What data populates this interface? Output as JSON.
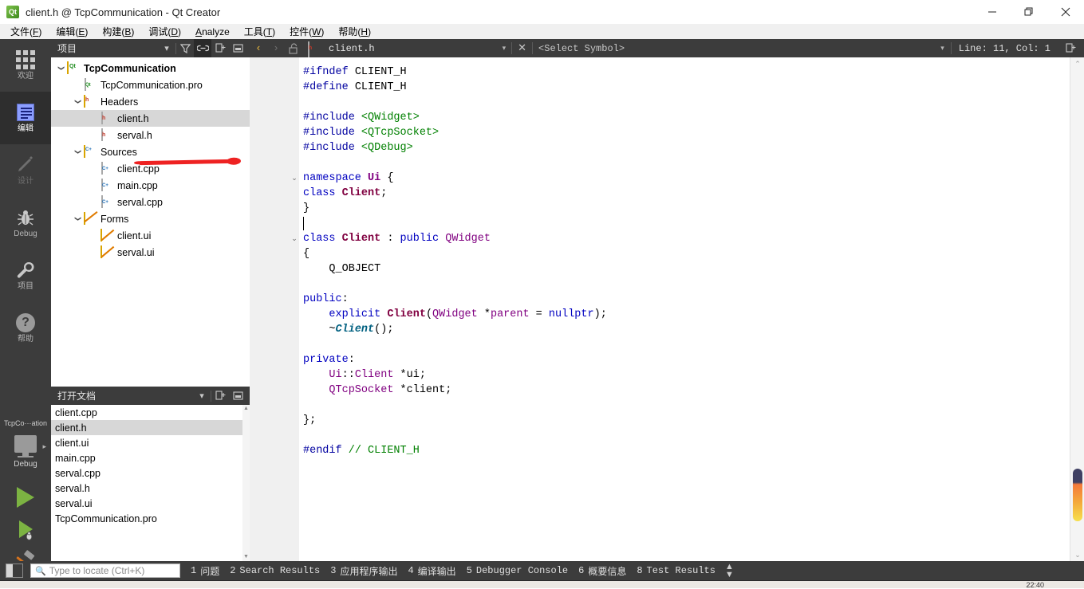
{
  "window": {
    "title": "client.h @ TcpCommunication - Qt Creator",
    "app_icon": "qt-logo-icon",
    "minimize": "—",
    "maximize": "❐",
    "close": "✕"
  },
  "menubar": {
    "items": [
      {
        "name": "file",
        "label": "文件(F)",
        "plain": "文件",
        "mnemonic": "F"
      },
      {
        "name": "edit",
        "label": "编辑(E)",
        "plain": "编辑",
        "mnemonic": "E"
      },
      {
        "name": "build",
        "label": "构建(B)",
        "plain": "构建",
        "mnemonic": "B"
      },
      {
        "name": "debug",
        "label": "调试(D)",
        "plain": "调试",
        "mnemonic": "D"
      },
      {
        "name": "analyze",
        "label": "Analyze",
        "plain": "Analyze",
        "mnemonic": "A"
      },
      {
        "name": "tools",
        "label": "工具(T)",
        "plain": "工具",
        "mnemonic": "T"
      },
      {
        "name": "widgets",
        "label": "控件(W)",
        "plain": "控件",
        "mnemonic": "W"
      },
      {
        "name": "help",
        "label": "帮助(H)",
        "plain": "帮助",
        "mnemonic": "H"
      }
    ]
  },
  "activitybar": {
    "modes": [
      {
        "name": "welcome",
        "label": "欢迎",
        "icon": "grid-icon",
        "state": "normal"
      },
      {
        "name": "edit",
        "label": "编辑",
        "icon": "edit-icon",
        "state": "active"
      },
      {
        "name": "design",
        "label": "设计",
        "icon": "pencil-icon",
        "state": "disabled"
      },
      {
        "name": "debug",
        "label": "Debug",
        "icon": "bug-icon",
        "state": "normal"
      },
      {
        "name": "projects",
        "label": "项目",
        "icon": "wrench-icon",
        "state": "normal"
      },
      {
        "name": "help",
        "label": "帮助",
        "icon": "question-icon",
        "state": "normal"
      }
    ],
    "kit_selector": {
      "project_name": "TcpCo···ation",
      "build_config": "Debug",
      "icon": "monitor-icon",
      "arrow": "▸"
    },
    "actions": [
      {
        "name": "run",
        "label": "",
        "icon": "run-triangle-icon"
      },
      {
        "name": "debug-run",
        "label": "",
        "icon": "run-debug-icon"
      },
      {
        "name": "build",
        "label": "",
        "icon": "hammer-icon"
      }
    ]
  },
  "project_panel": {
    "title": "项目",
    "dropdown": "▾",
    "buttons": [
      {
        "name": "filter",
        "icon": "filter-icon",
        "glyph": "▼",
        "active": false
      },
      {
        "name": "sync-selection",
        "icon": "link-icon",
        "glyph": "⚭",
        "active": true
      },
      {
        "name": "split",
        "icon": "split-add-icon",
        "glyph": "⬚",
        "active": false
      },
      {
        "name": "close-pane",
        "icon": "close-pane-icon",
        "glyph": "▣",
        "active": false
      }
    ],
    "tree": [
      {
        "name": "project-root",
        "label": "TcpCommunication",
        "depth": 0,
        "icon": "qt-project-icon",
        "twisty": "⌄",
        "bold": true,
        "selected": false
      },
      {
        "name": "file-pro",
        "label": "TcpCommunication.pro",
        "depth": 1,
        "icon": "pro-file-icon",
        "twisty": "",
        "bold": false,
        "selected": false
      },
      {
        "name": "folder-headers",
        "label": "Headers",
        "depth": 1,
        "icon": "headers-folder-icon",
        "twisty": "⌄",
        "bold": false,
        "selected": false
      },
      {
        "name": "file-client-h",
        "label": "client.h",
        "depth": 2,
        "icon": "h-file-icon",
        "twisty": "",
        "bold": false,
        "selected": true
      },
      {
        "name": "file-serval-h",
        "label": "serval.h",
        "depth": 2,
        "icon": "h-file-icon",
        "twisty": "",
        "bold": false,
        "selected": false
      },
      {
        "name": "folder-sources",
        "label": "Sources",
        "depth": 1,
        "icon": "sources-folder-icon",
        "twisty": "⌄",
        "bold": false,
        "selected": false
      },
      {
        "name": "file-client-cpp",
        "label": "client.cpp",
        "depth": 2,
        "icon": "cpp-file-icon",
        "twisty": "",
        "bold": false,
        "selected": false
      },
      {
        "name": "file-main-cpp",
        "label": "main.cpp",
        "depth": 2,
        "icon": "cpp-file-icon",
        "twisty": "",
        "bold": false,
        "selected": false
      },
      {
        "name": "file-serval-cpp",
        "label": "serval.cpp",
        "depth": 2,
        "icon": "cpp-file-icon",
        "twisty": "",
        "bold": false,
        "selected": false
      },
      {
        "name": "folder-forms",
        "label": "Forms",
        "depth": 1,
        "icon": "forms-folder-icon",
        "twisty": "⌄",
        "bold": false,
        "selected": false
      },
      {
        "name": "file-client-ui",
        "label": "client.ui",
        "depth": 2,
        "icon": "ui-file-icon",
        "twisty": "",
        "bold": false,
        "selected": false
      },
      {
        "name": "file-serval-ui",
        "label": "serval.ui",
        "depth": 2,
        "icon": "ui-file-icon",
        "twisty": "",
        "bold": false,
        "selected": false
      }
    ],
    "annotation": {
      "name": "red-underline-annotation",
      "color": "#ee2222",
      "target": "client.h"
    }
  },
  "open_documents": {
    "title": "打开文档",
    "dropdown": "▾",
    "buttons": [
      {
        "name": "split-add",
        "glyph": "⬚"
      },
      {
        "name": "close-pane",
        "glyph": "▣"
      }
    ],
    "items": [
      {
        "name": "doc-client-cpp",
        "label": "client.cpp",
        "selected": false
      },
      {
        "name": "doc-client-h",
        "label": "client.h",
        "selected": true
      },
      {
        "name": "doc-client-ui",
        "label": "client.ui",
        "selected": false
      },
      {
        "name": "doc-main-cpp",
        "label": "main.cpp",
        "selected": false
      },
      {
        "name": "doc-serval-cpp",
        "label": "serval.cpp",
        "selected": false
      },
      {
        "name": "doc-serval-h",
        "label": "serval.h",
        "selected": false
      },
      {
        "name": "doc-serval-ui",
        "label": "serval.ui",
        "selected": false
      },
      {
        "name": "doc-pro",
        "label": "TcpCommunication.pro",
        "selected": false
      }
    ]
  },
  "editor": {
    "toolbar": {
      "back": "‹",
      "forward": "›",
      "lock_icon": "unlocked-icon",
      "file_icon": "h-file-icon",
      "filename": "client.h",
      "file_dropdown": "▾",
      "close": "✕",
      "symbol_selector": "<Select Symbol>",
      "symbol_dropdown": "▾",
      "line_col": "Line: 11, Col: 1",
      "split_icon": "split-add-icon"
    },
    "line_count": 27,
    "cursor_line": 11,
    "cursor_col": 1,
    "fold_lines": [
      8,
      12
    ],
    "lines": [
      {
        "n": 1,
        "tokens": [
          {
            "t": "#ifndef ",
            "c": "k-pre"
          },
          {
            "t": "CLIENT_H",
            "c": "k-txt"
          }
        ]
      },
      {
        "n": 2,
        "tokens": [
          {
            "t": "#define ",
            "c": "k-pre"
          },
          {
            "t": "CLIENT_H",
            "c": "k-txt"
          }
        ]
      },
      {
        "n": 3,
        "tokens": []
      },
      {
        "n": 4,
        "tokens": [
          {
            "t": "#include ",
            "c": "k-pre"
          },
          {
            "t": "<QWidget>",
            "c": "k-inc"
          }
        ]
      },
      {
        "n": 5,
        "tokens": [
          {
            "t": "#include ",
            "c": "k-pre"
          },
          {
            "t": "<QTcpSocket>",
            "c": "k-inc"
          }
        ]
      },
      {
        "n": 6,
        "tokens": [
          {
            "t": "#include ",
            "c": "k-pre"
          },
          {
            "t": "<QDebug>",
            "c": "k-inc"
          }
        ]
      },
      {
        "n": 7,
        "tokens": []
      },
      {
        "n": 8,
        "tokens": [
          {
            "t": "namespace ",
            "c": "k-kw"
          },
          {
            "t": "Ui",
            "c": "k-cls2"
          },
          {
            "t": " {",
            "c": "k-op"
          }
        ]
      },
      {
        "n": 9,
        "tokens": [
          {
            "t": "class ",
            "c": "k-kw"
          },
          {
            "t": "Client",
            "c": "k-cls"
          },
          {
            "t": ";",
            "c": "k-op"
          }
        ]
      },
      {
        "n": 10,
        "tokens": [
          {
            "t": "}",
            "c": "k-op"
          }
        ]
      },
      {
        "n": 11,
        "tokens": []
      },
      {
        "n": 12,
        "tokens": [
          {
            "t": "class ",
            "c": "k-kw"
          },
          {
            "t": "Client",
            "c": "k-cls"
          },
          {
            "t": " : ",
            "c": "k-op"
          },
          {
            "t": "public ",
            "c": "k-kw"
          },
          {
            "t": "QWidget",
            "c": "k-type"
          }
        ]
      },
      {
        "n": 13,
        "tokens": [
          {
            "t": "{",
            "c": "k-op"
          }
        ]
      },
      {
        "n": 14,
        "tokens": [
          {
            "t": "    Q_OBJECT",
            "c": "k-txt"
          }
        ]
      },
      {
        "n": 15,
        "tokens": []
      },
      {
        "n": 16,
        "tokens": [
          {
            "t": "public",
            "c": "k-kw"
          },
          {
            "t": ":",
            "c": "k-op"
          }
        ]
      },
      {
        "n": 17,
        "tokens": [
          {
            "t": "    ",
            "c": "k-op"
          },
          {
            "t": "explicit ",
            "c": "k-kw"
          },
          {
            "t": "Client",
            "c": "k-cls"
          },
          {
            "t": "(",
            "c": "k-op"
          },
          {
            "t": "QWidget",
            "c": "k-type"
          },
          {
            "t": " *",
            "c": "k-op"
          },
          {
            "t": "parent",
            "c": "k-type"
          },
          {
            "t": " = ",
            "c": "k-op"
          },
          {
            "t": "nullptr",
            "c": "k-kw"
          },
          {
            "t": ");",
            "c": "k-op"
          }
        ]
      },
      {
        "n": 18,
        "tokens": [
          {
            "t": "    ~",
            "c": "k-op"
          },
          {
            "t": "Client",
            "c": "k-fn"
          },
          {
            "t": "();",
            "c": "k-op"
          }
        ]
      },
      {
        "n": 19,
        "tokens": []
      },
      {
        "n": 20,
        "tokens": [
          {
            "t": "private",
            "c": "k-kw"
          },
          {
            "t": ":",
            "c": "k-op"
          }
        ]
      },
      {
        "n": 21,
        "tokens": [
          {
            "t": "    ",
            "c": "k-op"
          },
          {
            "t": "Ui",
            "c": "k-type"
          },
          {
            "t": "::",
            "c": "k-op"
          },
          {
            "t": "Client",
            "c": "k-type"
          },
          {
            "t": " *ui;",
            "c": "k-op"
          }
        ]
      },
      {
        "n": 22,
        "tokens": [
          {
            "t": "    ",
            "c": "k-op"
          },
          {
            "t": "QTcpSocket",
            "c": "k-type"
          },
          {
            "t": " *client;",
            "c": "k-op"
          }
        ]
      },
      {
        "n": 23,
        "tokens": []
      },
      {
        "n": 24,
        "tokens": [
          {
            "t": "};",
            "c": "k-op"
          }
        ]
      },
      {
        "n": 25,
        "tokens": []
      },
      {
        "n": 26,
        "tokens": [
          {
            "t": "#endif ",
            "c": "k-pre"
          },
          {
            "t": "// CLIENT_H",
            "c": "k-cmt"
          }
        ]
      },
      {
        "n": 27,
        "tokens": []
      }
    ],
    "scrollbar": {
      "up": "⌃",
      "down": "⌄",
      "marker_colors": [
        "#3f4063",
        "#f4793a",
        "#f6e04e"
      ]
    }
  },
  "statusbar": {
    "sidebar_toggle": "sidebar-toggle-icon",
    "locator": {
      "icon": "search-icon",
      "placeholder": "Type to locate (Ctrl+K)",
      "value": ""
    },
    "panes": [
      {
        "name": "issues",
        "num": "1",
        "label": "问题"
      },
      {
        "name": "search-results",
        "num": "2",
        "label": "Search Results"
      },
      {
        "name": "app-output",
        "num": "3",
        "label": "应用程序输出"
      },
      {
        "name": "compile-output",
        "num": "4",
        "label": "编译输出"
      },
      {
        "name": "debugger-console",
        "num": "5",
        "label": "Debugger Console"
      },
      {
        "name": "general-messages",
        "num": "6",
        "label": "概要信息"
      },
      {
        "name": "test-results",
        "num": "8",
        "label": "Test Results"
      }
    ],
    "size_toggle": "↕"
  },
  "taskbar": {
    "clock": "22:40"
  }
}
